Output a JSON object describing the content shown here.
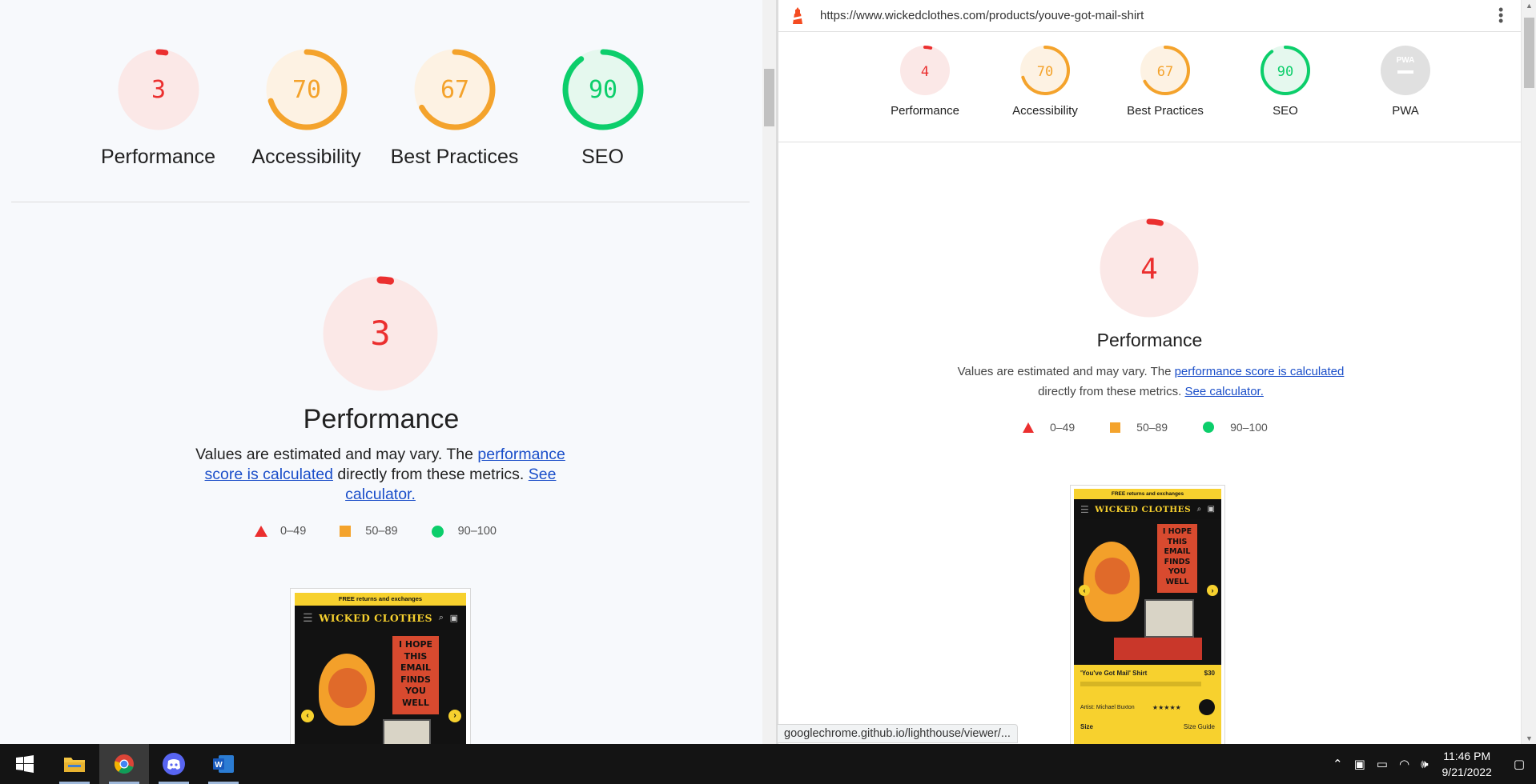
{
  "left": {
    "gauges": [
      {
        "score": "3",
        "label": "Performance",
        "fraction": 0.03,
        "color": "#eb2f2f",
        "bg": "#fbe8e7"
      },
      {
        "score": "70",
        "label": "Accessibility",
        "fraction": 0.7,
        "color": "#f4a32c",
        "bg": "#fdf2e3"
      },
      {
        "score": "67",
        "label": "Best Practices",
        "fraction": 0.67,
        "color": "#f4a32c",
        "bg": "#fdf2e3"
      },
      {
        "score": "90",
        "label": "SEO",
        "fraction": 0.9,
        "color": "#0cce6b",
        "bg": "#e5f8ee"
      }
    ],
    "big_score": "3",
    "title": "Performance",
    "desc_pre": "Values are estimated and may vary. The ",
    "desc_link1": "performance score is calculated",
    "desc_mid": " directly from these metrics. ",
    "desc_link2": "See calculator.",
    "legend": [
      "0–49",
      "50–89",
      "90–100"
    ]
  },
  "screenshot": {
    "banner": "FREE returns and exchanges",
    "brand": "WICKED CLOTHES",
    "sign": "I HOPE THIS EMAIL FINDS YOU WELL",
    "product": "'You've Got Mail' Shirt",
    "price": "$30",
    "artist": "Artist: Michael Buxton",
    "size": "Size",
    "size_guide": "Size Guide"
  },
  "right": {
    "url": "https://www.wickedclothes.com/products/youve-got-mail-shirt",
    "gauges": [
      {
        "score": "4",
        "label": "Performance",
        "fraction": 0.04,
        "color": "#eb2f2f",
        "bg": "#fbe8e7"
      },
      {
        "score": "70",
        "label": "Accessibility",
        "fraction": 0.7,
        "color": "#f4a32c",
        "bg": "#fdf2e3"
      },
      {
        "score": "67",
        "label": "Best Practices",
        "fraction": 0.67,
        "color": "#f4a32c",
        "bg": "#fdf2e3"
      },
      {
        "score": "90",
        "label": "SEO",
        "fraction": 0.9,
        "color": "#0cce6b",
        "bg": "#e5f8ee"
      },
      {
        "score": "PWA",
        "label": "PWA",
        "fraction": 0,
        "color": "#9e9e9e",
        "bg": "#e0e0e0"
      }
    ],
    "big_score": "4",
    "title": "Performance",
    "desc_pre": "Values are estimated and may vary. The ",
    "desc_link1": "performance score is calculated",
    "desc_mid": " directly from these metrics. ",
    "desc_link2": "See calculator.",
    "legend": [
      "0–49",
      "50–89",
      "90–100"
    ]
  },
  "status_url": "googlechrome.github.io/lighthouse/viewer/...",
  "taskbar": {
    "apps": [
      "start-icon",
      "file-explorer-icon",
      "chrome-icon",
      "discord-icon",
      "word-icon"
    ],
    "time": "11:46 PM",
    "date": "9/21/2022"
  }
}
